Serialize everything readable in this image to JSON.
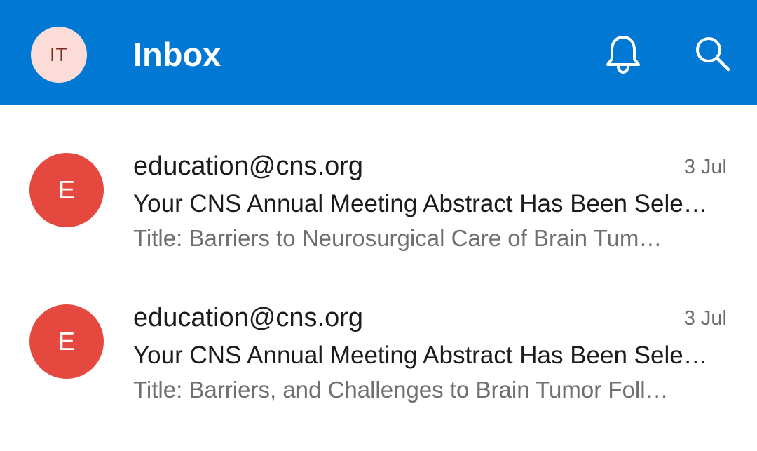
{
  "header": {
    "avatar_initials": "IT",
    "title": "Inbox",
    "bell_icon": "bell-icon",
    "search_icon": "search-icon",
    "background_color": "#0078d4"
  },
  "emails": [
    {
      "avatar_letter": "E",
      "sender": "education@cns.org",
      "date": "3 Jul",
      "subject": "Your CNS Annual Meeting Abstract Has Been Sele…",
      "preview": "Title: Barriers to Neurosurgical Care of Brain Tum…",
      "avatar_color": "#e5483f"
    },
    {
      "avatar_letter": "E",
      "sender": "education@cns.org",
      "date": "3 Jul",
      "subject": "Your CNS Annual Meeting Abstract Has Been Sele…",
      "preview": "Title: Barriers, and Challenges to Brain Tumor Foll…",
      "avatar_color": "#e5483f"
    }
  ]
}
